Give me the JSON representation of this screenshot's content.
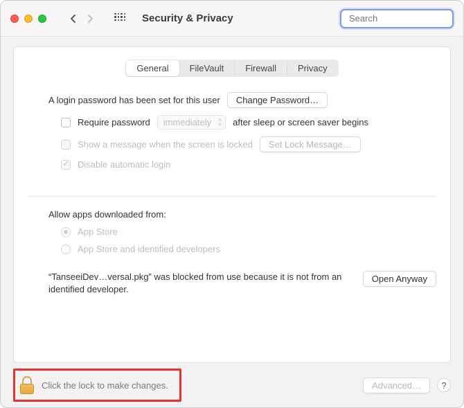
{
  "window": {
    "title": "Security & Privacy"
  },
  "search": {
    "placeholder": "Search",
    "value": ""
  },
  "tabs": {
    "general": "General",
    "filevault": "FileVault",
    "firewall": "Firewall",
    "privacy": "Privacy"
  },
  "general": {
    "login_password_set": "A login password has been set for this user",
    "change_password": "Change Password…",
    "require_password": "Require password",
    "require_password_delay": "immediately",
    "require_password_after": "after sleep or screen saver begins",
    "show_message": "Show a message when the screen is locked",
    "set_lock_message": "Set Lock Message…",
    "disable_auto_login": "Disable automatic login"
  },
  "allow": {
    "label": "Allow apps downloaded from:",
    "app_store": "App Store",
    "app_store_identified": "App Store and identified developers",
    "blocked_msg": "“TanseeiDev…versal.pkg” was blocked from use because it is not from an identified developer.",
    "open_anyway": "Open Anyway"
  },
  "footer": {
    "lock_hint": "Click the lock to make changes.",
    "advanced": "Advanced…",
    "help": "?"
  }
}
